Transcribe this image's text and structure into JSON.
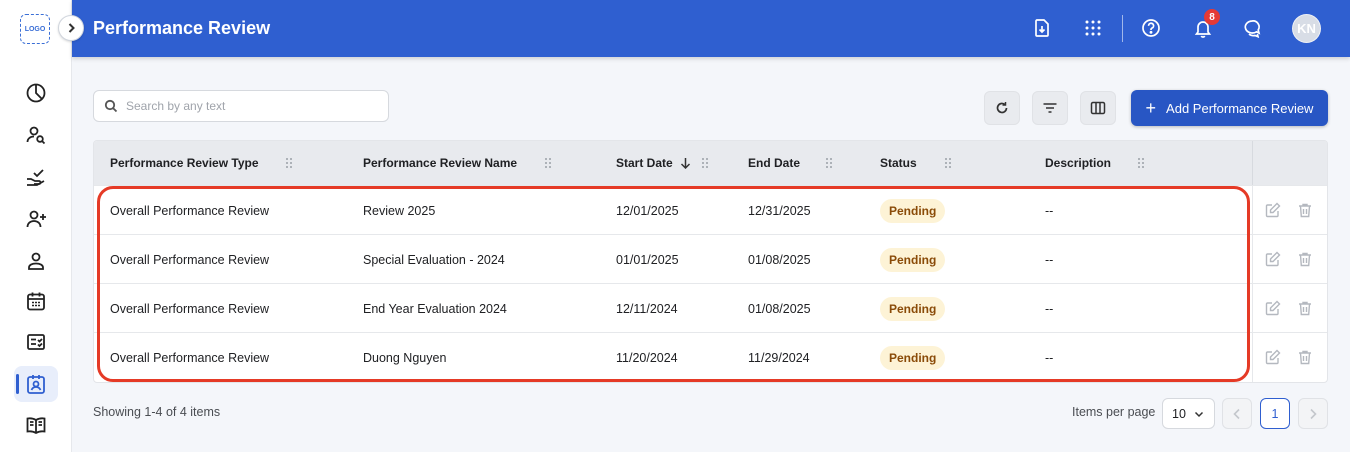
{
  "app": {
    "logo_text": "LOGO",
    "title": "Performance Review"
  },
  "header": {
    "notification_count": "8",
    "avatar_initials": "KN"
  },
  "toolbar": {
    "search_placeholder": "Search by any text",
    "add_button_label": "Add Performance Review"
  },
  "table": {
    "columns": [
      "Performance Review Type",
      "Performance Review Name",
      "Start Date",
      "End Date",
      "Status",
      "Description"
    ],
    "sorted_column": "Start Date",
    "sort_direction": "descending",
    "rows": [
      {
        "type": "Overall Performance Review",
        "name": "Review 2025",
        "start": "12/01/2025",
        "end": "12/31/2025",
        "status": "Pending",
        "description": "--"
      },
      {
        "type": "Overall Performance Review",
        "name": "Special Evaluation - 2024",
        "start": "01/01/2025",
        "end": "01/08/2025",
        "status": "Pending",
        "description": "--"
      },
      {
        "type": "Overall Performance Review",
        "name": "End Year Evaluation 2024",
        "start": "12/11/2024",
        "end": "01/08/2025",
        "status": "Pending",
        "description": "--"
      },
      {
        "type": "Overall Performance Review",
        "name": "Duong Nguyen",
        "start": "11/20/2024",
        "end": "11/29/2024",
        "status": "Pending",
        "description": "--"
      }
    ]
  },
  "footer": {
    "showing_text": "Showing 1-4 of 4 items",
    "items_per_page_label": "Items per page",
    "items_per_page_value": "10",
    "current_page": "1"
  },
  "colors": {
    "primary": "#2f5fd0",
    "button": "#2856c4",
    "highlight": "#e53a26",
    "status_bg": "#fdf3d6",
    "status_text": "#8a4b08"
  },
  "icons": {
    "sidebar": [
      "pie-chart-icon",
      "user-search-icon",
      "hand-check-icon",
      "user-add-icon",
      "user-icon",
      "calendar-icon",
      "checklist-icon",
      "performance-review-icon",
      "book-icon"
    ],
    "header": [
      "download-file-icon",
      "apps-grid-icon",
      "help-icon",
      "bell-icon",
      "chat-icon"
    ],
    "toolbar": [
      "refresh-icon",
      "filter-icon",
      "columns-icon",
      "plus-icon"
    ],
    "row_actions": [
      "edit-icon",
      "delete-icon"
    ]
  }
}
